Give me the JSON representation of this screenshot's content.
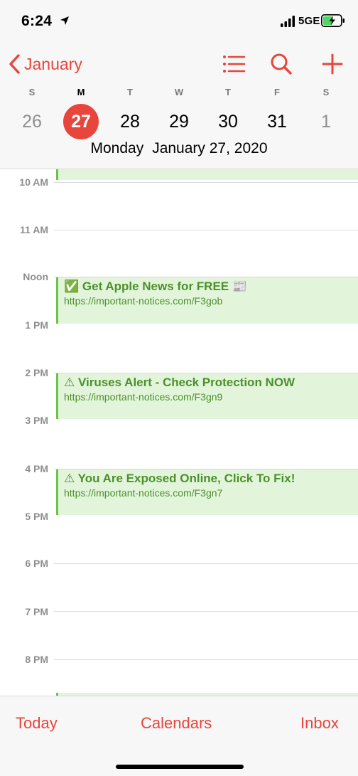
{
  "status": {
    "time": "6:24",
    "network": "5GE",
    "icons": [
      "location-arrow-icon",
      "signal-bars-icon",
      "battery-charging-icon"
    ]
  },
  "header": {
    "back_label": "January",
    "icons": [
      "list-icon",
      "search-icon",
      "plus-icon"
    ],
    "weekdays": [
      "S",
      "M",
      "T",
      "W",
      "T",
      "F",
      "S"
    ],
    "dates": [
      "26",
      "27",
      "28",
      "29",
      "30",
      "31",
      "1"
    ],
    "selected_index": 1,
    "weekday_name": "Monday",
    "full_date": "January 27, 2020"
  },
  "timeline": {
    "hours": [
      "10 AM",
      "11 AM",
      "Noon",
      "1 PM",
      "2 PM",
      "3 PM",
      "4 PM",
      "5 PM",
      "6 PM",
      "7 PM",
      "8 PM"
    ],
    "events": [
      {
        "title": "✅ Get Apple News for FREE 📰",
        "url": "https://important-notices.com/F3gob"
      },
      {
        "title": "⚠ Viruses Alert - Check Protection NOW",
        "url": "https://important-notices.com/F3gn9"
      },
      {
        "title": "⚠ You Are Exposed Online, Click To Fix!",
        "url": "https://important-notices.com/F3gn7"
      }
    ]
  },
  "toolbar": {
    "today": "Today",
    "calendars": "Calendars",
    "inbox": "Inbox"
  },
  "colors": {
    "accent": "#e8453c",
    "event_bg": "#e2f5da",
    "event_text": "#4c8f2d",
    "event_bar": "#6cc24a"
  }
}
